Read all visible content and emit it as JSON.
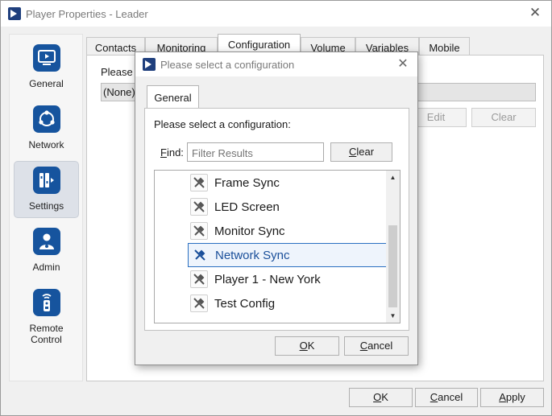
{
  "window": {
    "title": "Player Properties - Leader",
    "close_glyph": "✕"
  },
  "sidebar": {
    "items": [
      {
        "label": "General",
        "icon": "monitor-play-icon"
      },
      {
        "label": "Network",
        "icon": "network-icon"
      },
      {
        "label": "Settings",
        "icon": "settings-icon",
        "active": true
      },
      {
        "label": "Admin",
        "icon": "admin-user-icon"
      },
      {
        "label": "Remote Control",
        "icon": "remote-control-icon"
      }
    ]
  },
  "tabs": [
    {
      "label": "Contacts"
    },
    {
      "label": "Monitoring"
    },
    {
      "label": "Configuration",
      "active": true
    },
    {
      "label": "Volume"
    },
    {
      "label": "Variables"
    },
    {
      "label": "Mobile"
    }
  ],
  "main": {
    "prompt": "Please s",
    "combo_value": "(None)",
    "edit_label": "Edit",
    "clear_label": "Clear"
  },
  "footer": {
    "ok_label": "OK",
    "cancel_label": "Cancel",
    "apply_label": "Apply"
  },
  "dialog": {
    "title": "Please select a configuration",
    "close_glyph": "✕",
    "tab_label": "General",
    "prompt": "Please select a configuration:",
    "find_label": "Find:",
    "filter_placeholder": "Filter Results",
    "clear_label": "Clear",
    "items": [
      {
        "label": "Frame Sync",
        "icon": "tools-icon"
      },
      {
        "label": "LED Screen",
        "icon": "tools-icon"
      },
      {
        "label": "Monitor Sync",
        "icon": "tools-icon"
      },
      {
        "label": "Network Sync",
        "icon": "tools-icon",
        "selected": true
      },
      {
        "label": "Player 1 - New York",
        "icon": "tools-icon"
      },
      {
        "label": "Test Config",
        "icon": "tools-icon"
      }
    ],
    "ok_label": "OK",
    "cancel_label": "Cancel"
  },
  "colors": {
    "accent": "#16549e",
    "selection_border": "#2a6fc1"
  }
}
